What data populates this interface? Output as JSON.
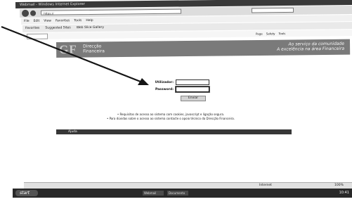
{
  "window": {
    "title": "Webmail - Windows Internet Explorer"
  },
  "address": {
    "url": "https://",
    "search_placeholder": ""
  },
  "menu": [
    "File",
    "Edit",
    "View",
    "Favorites",
    "Tools",
    "Help"
  ],
  "favorites": [
    "Favorites",
    "Suggested Sites",
    "Web Slice Gallery"
  ],
  "tab": {
    "tools": [
      "Page",
      "Safety",
      "Tools"
    ]
  },
  "banner": {
    "logo": "GF",
    "name_line1": "Direcção",
    "name_line2": "Financeira",
    "slogan_line1": "Ao serviço da comunidade",
    "slogan_line2": "A excelência na área Financeira"
  },
  "login": {
    "username_label": "Utilizador:",
    "password_label": "Password:",
    "submit_label": "Enviar"
  },
  "notice": {
    "line1": "• Requisitos de acesso ao sistema com cookies, javascript e ligação segura.",
    "line2": "• Para dúvidas sobre o acesso ao sistema contacte o apoio técnico da Direcção Financeira."
  },
  "footer": {
    "label": "Ajuda"
  },
  "status": {
    "zone": "Internet",
    "zoom": "100%"
  },
  "taskbar": {
    "start": "start",
    "items": [
      "Webmail",
      "Documento"
    ],
    "clock": "10:41"
  }
}
